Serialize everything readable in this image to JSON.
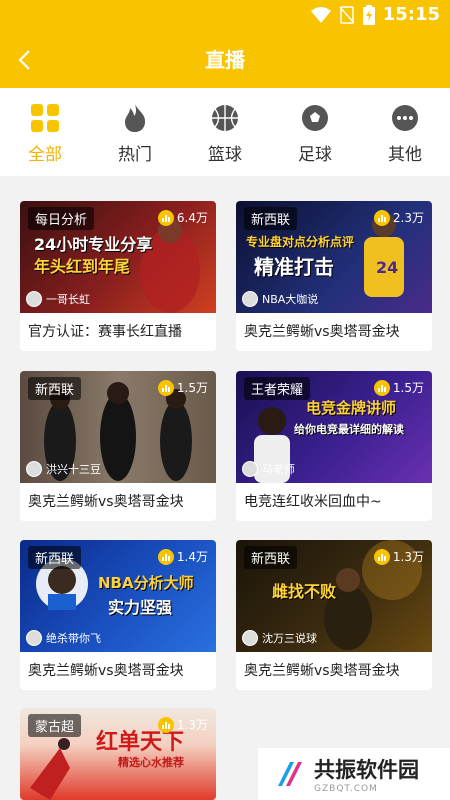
{
  "status": {
    "time": "15:15"
  },
  "header": {
    "title": "直播"
  },
  "categories": [
    {
      "label": "全部",
      "icon": "grid-icon",
      "active": true
    },
    {
      "label": "热门",
      "icon": "flame-icon"
    },
    {
      "label": "篮球",
      "icon": "basketball-icon"
    },
    {
      "label": "足球",
      "icon": "soccer-ball-icon"
    },
    {
      "label": "其他",
      "icon": "more-icon"
    }
  ],
  "cards": [
    {
      "tag": "每日分析",
      "views": "6.4万",
      "anchor": "一哥长虹",
      "title": "官方认证：赛事长红直播",
      "banner": [
        "24小时专业分享",
        "年头红到年尾"
      ]
    },
    {
      "tag": "新西联",
      "views": "2.3万",
      "anchor": "NBA大咖说",
      "title": "奥克兰鳄蜥vs奥塔哥金块",
      "banner": [
        "专业盘对点分析点评",
        "精准打击"
      ]
    },
    {
      "tag": "新西联",
      "views": "1.5万",
      "anchor": "洪兴十三豆",
      "title": "奥克兰鳄蜥vs奥塔哥金块",
      "banner": []
    },
    {
      "tag": "王者荣耀",
      "views": "1.5万",
      "anchor": "马老师",
      "title": "电竞连红收米回血中~",
      "banner": [
        "电竞金牌讲师",
        "给你电竞最详细的解读"
      ]
    },
    {
      "tag": "新西联",
      "views": "1.4万",
      "anchor": "绝杀带你飞",
      "title": "奥克兰鳄蜥vs奥塔哥金块",
      "banner": [
        "NBA分析大师",
        "实力坚强"
      ]
    },
    {
      "tag": "新西联",
      "views": "1.3万",
      "anchor": "沈万三说球",
      "title": "奥克兰鳄蜥vs奥塔哥金块",
      "banner": [
        "雌找不败"
      ]
    },
    {
      "tag": "蒙古超",
      "views": "1.3万",
      "anchor": "",
      "title": "",
      "banner": [
        "红单天下",
        "精选心水推荐"
      ]
    }
  ],
  "watermark": {
    "title": "共振软件园",
    "sub": "GZBQT.COM"
  },
  "colors": {
    "brand": "#f8c400",
    "active_text": "#f2b300"
  }
}
